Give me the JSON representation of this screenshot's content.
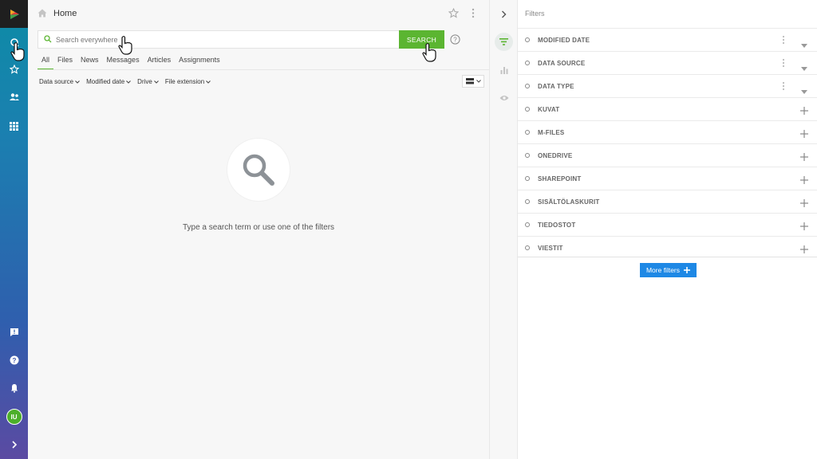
{
  "header": {
    "title": "Home"
  },
  "search": {
    "placeholder": "Search everywhere",
    "button_label": "SEARCH"
  },
  "tabs": [
    {
      "label": "All",
      "active": true
    },
    {
      "label": "Files"
    },
    {
      "label": "News"
    },
    {
      "label": "Messages"
    },
    {
      "label": "Articles"
    },
    {
      "label": "Assignments"
    }
  ],
  "filter_dropdowns": [
    {
      "label": "Data source"
    },
    {
      "label": "Modified date"
    },
    {
      "label": "Drive"
    },
    {
      "label": "File extension"
    }
  ],
  "empty_state": {
    "message": "Type a search term or use one of the filters"
  },
  "filters_panel": {
    "title": "Filters",
    "items": [
      {
        "label": "MODIFIED DATE",
        "control": "dropdown"
      },
      {
        "label": "DATA SOURCE",
        "control": "dropdown"
      },
      {
        "label": "DATA TYPE",
        "control": "dropdown"
      },
      {
        "label": "KUVAT",
        "control": "add"
      },
      {
        "label": "M-FILES",
        "control": "add"
      },
      {
        "label": "ONEDRIVE",
        "control": "add"
      },
      {
        "label": "SHAREPOINT",
        "control": "add"
      },
      {
        "label": "SISÄLTÖLASKURIT",
        "control": "add"
      },
      {
        "label": "TIEDOSTOT",
        "control": "add"
      },
      {
        "label": "VIESTIT",
        "control": "add"
      }
    ],
    "more_label": "More filters"
  },
  "user": {
    "initials": "IU"
  },
  "colors": {
    "accent_green": "#5bb531",
    "accent_blue": "#1e88e5",
    "avatar_green": "#4caf2a"
  }
}
